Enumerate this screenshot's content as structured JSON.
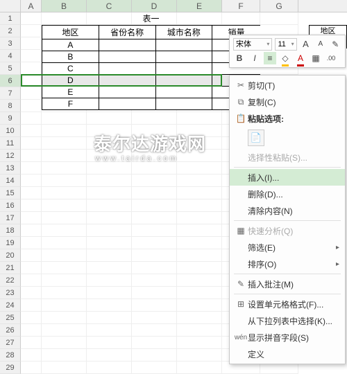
{
  "columns": [
    "A",
    "B",
    "C",
    "D",
    "E",
    "F",
    "G"
  ],
  "rows_count": 29,
  "selected_row": 6,
  "table": {
    "title": "表一",
    "headers": [
      "地区",
      "省份名称",
      "城市名称",
      "销量"
    ],
    "data_col1": [
      "A",
      "B",
      "C",
      "D",
      "E",
      "F"
    ]
  },
  "right_fragment": {
    "label": "地区"
  },
  "mini_toolbar": {
    "font": "宋体",
    "size": "11",
    "btn_bigA": "A",
    "btn_smallA": "A",
    "btn_bold": "B",
    "btn_italic": "I"
  },
  "context_menu": {
    "cut": "剪切(T)",
    "copy": "复制(C)",
    "paste_section": "粘贴选项:",
    "paste_special": "选择性粘贴(S)...",
    "insert": "插入(I)...",
    "delete": "删除(D)...",
    "clear": "清除内容(N)",
    "quick_analysis": "快速分析(Q)",
    "filter": "筛选(E)",
    "sort": "排序(O)",
    "insert_comment": "插入批注(M)",
    "format_cells": "设置单元格格式(F)...",
    "pick_from_list": "从下拉列表中选择(K)...",
    "show_pinyin": "显示拼音字段(S)",
    "define_name": "定义"
  },
  "watermark": {
    "big": "泰尔达游戏网",
    "small": "www.tairda.com"
  }
}
